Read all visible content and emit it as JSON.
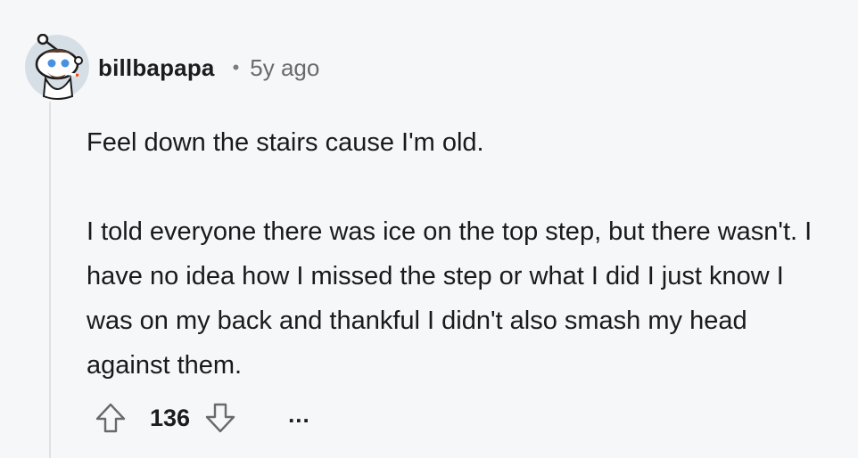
{
  "comment": {
    "username": "billbapapa",
    "separator": "•",
    "time": "5y ago",
    "paragraphs": [
      "Feel down the stairs cause I'm old.",
      "I told everyone there was ice on the top step, but there wasn't. I have no idea how I missed the step or what I did I just know I was on my back and thankful I didn't also smash my head against them."
    ],
    "score": "136",
    "more_label": "..."
  },
  "icons": {
    "avatar": "reddit-snoo-avatar",
    "upvote": "upvote-arrow-icon",
    "downvote": "downvote-arrow-icon",
    "more": "more-options-icon"
  },
  "colors": {
    "background": "#f6f7f8",
    "text": "#1c1c1c",
    "muted": "#6a6a6a",
    "thread_line": "#dfe2e5"
  }
}
